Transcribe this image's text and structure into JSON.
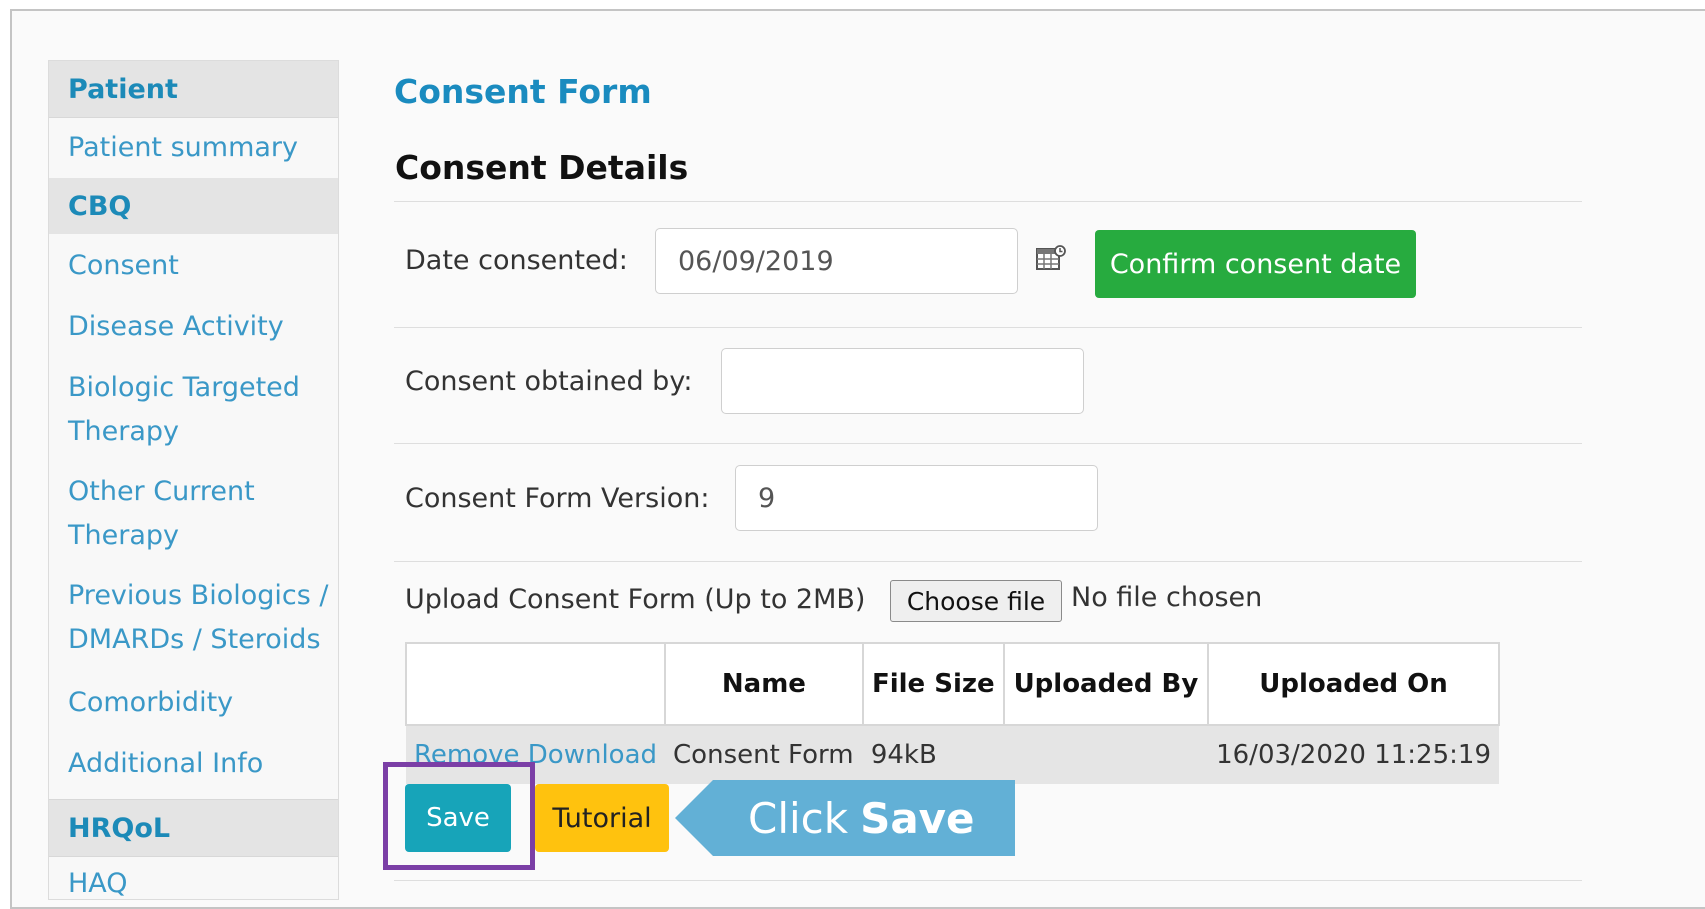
{
  "sidebar": {
    "headers": [
      "Patient",
      "CBQ",
      "HRQoL"
    ],
    "items": {
      "patient_summary": "Patient summary",
      "consent": "Consent",
      "disease_activity": "Disease Activity",
      "biologic_line1": "Biologic Targeted",
      "biologic_line2": "Therapy",
      "other_line1": "Other Current",
      "other_line2": "Therapy",
      "previous_line1": "Previous Biologics /",
      "previous_line2": "DMARDs / Steroids",
      "comorbidity": "Comorbidity",
      "additional_info": "Additional Info",
      "haq": "HAQ"
    }
  },
  "main": {
    "title": "Consent Form",
    "section_title": "Consent Details",
    "date_consented": {
      "label": "Date consented:",
      "value": "06/09/2019"
    },
    "confirm_button": "Confirm consent date",
    "obtained_by": {
      "label": "Consent obtained by:",
      "value": ""
    },
    "form_version": {
      "label": "Consent Form Version:",
      "value": "9"
    },
    "upload": {
      "label": "Upload Consent Form (Up to 2MB)",
      "choose_file": "Choose file",
      "no_file": "No file chosen"
    },
    "table": {
      "headers": [
        "",
        "Name",
        "File Size",
        "Uploaded By",
        "Uploaded On"
      ],
      "row": {
        "remove": "Remove",
        "download": "Download",
        "name": "Consent Form",
        "size": "94kB",
        "uploaded_by": "",
        "uploaded_on": "16/03/2020 11:25:19"
      }
    },
    "save_button": "Save",
    "tutorial_button": "Tutorial",
    "callout": {
      "prefix": "Click",
      "emphasis": "Save"
    }
  },
  "colors": {
    "link": "#3a98c7",
    "title": "#1a8bbf",
    "confirm": "#27ab3f",
    "save": "#17a4b9",
    "tutorial": "#ffc20e",
    "highlight": "#7b3fa6",
    "callout": "#62b0d6"
  },
  "icons": {
    "calendar": "calendar-icon"
  }
}
